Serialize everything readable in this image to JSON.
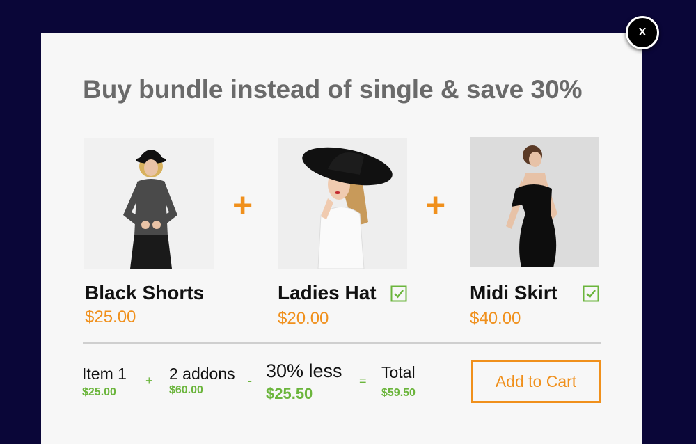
{
  "modal": {
    "close_label": "X",
    "title": "Buy bundle instead of single & save 30%"
  },
  "products": [
    {
      "name": "Black Shorts",
      "price": "$25.00",
      "checked": false,
      "image": "woman-in-sweater-and-hat-photo"
    },
    {
      "name": "Ladies Hat",
      "price": "$20.00",
      "checked": true,
      "image": "woman-in-wide-black-hat-photo"
    },
    {
      "name": "Midi Skirt",
      "price": "$40.00",
      "checked": true,
      "image": "woman-in-black-dress-photo"
    }
  ],
  "plus_symbol": "+",
  "summary": {
    "item_label": "Item 1",
    "item_value": "$25.00",
    "op_plus": "+",
    "addons_label": "2 addons",
    "addons_value": "$60.00",
    "op_minus": "-",
    "discount_label": "30% less",
    "discount_value": "$25.50",
    "op_equals": "=",
    "total_label": "Total",
    "total_value": "$59.50"
  },
  "add_to_cart_label": "Add to Cart",
  "colors": {
    "accent_orange": "#f0901c",
    "check_green": "#6bb53c",
    "background_navy": "#0a0638"
  }
}
